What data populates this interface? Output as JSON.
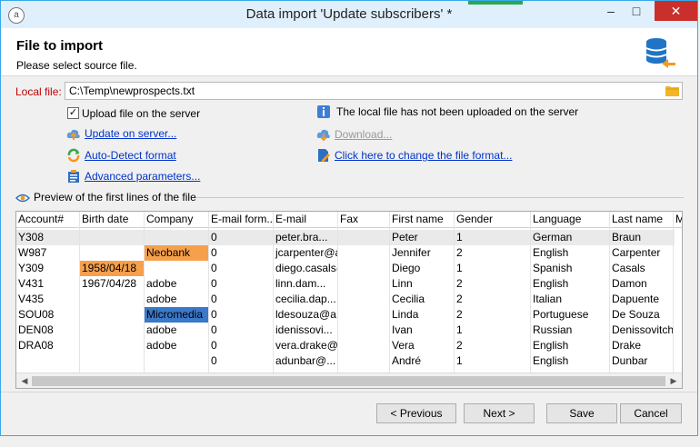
{
  "window": {
    "title": "Data import 'Update subscribers' *",
    "app_icon": "app-logo-icon"
  },
  "header": {
    "title": "File to import",
    "subtitle": "Please select source file."
  },
  "local_file": {
    "label": "Local file:",
    "value": "C:\\Temp\\newprospects.txt"
  },
  "options": {
    "upload_label": "Upload file on the server",
    "upload_checked": true,
    "info_text": "The local file has not been uploaded on the server",
    "update_link": "Update on server...",
    "autodetect_link": "Auto-Detect format",
    "advanced_link": "Advanced parameters...",
    "download_link": "Download...",
    "change_format_link": "Click here to change the file format..."
  },
  "preview": {
    "label": "Preview of the first lines of the file",
    "columns": [
      "Account#",
      "Birth date",
      "Company",
      "E-mail form...",
      "E-mail",
      "Fax",
      "First name",
      "Gender",
      "Language",
      "Last name",
      "M"
    ],
    "rows": [
      [
        "Y308",
        "",
        "",
        "0",
        "peter.bra...",
        "",
        "Peter",
        "1",
        "German",
        "Braun"
      ],
      [
        "W987",
        "",
        "Neobank",
        "0",
        "jcarpenter@a",
        "",
        "Jennifer",
        "2",
        "English",
        "Carpenter"
      ],
      [
        "Y309",
        "1958/04/18",
        "",
        "0",
        "diego.casals@",
        "",
        "Diego",
        "1",
        "Spanish",
        "Casals"
      ],
      [
        "V431",
        "1967/04/28",
        "adobe",
        "0",
        "linn.dam...",
        "",
        "Linn",
        "2",
        "English",
        "Damon"
      ],
      [
        "V435",
        "",
        "adobe",
        "0",
        "cecilia.dap...",
        "",
        "Cecilia",
        "2",
        "Italian",
        "Dapuente"
      ],
      [
        "SOU08",
        "",
        "Micromedia",
        "0",
        "ldesouza@a...",
        "",
        "Linda",
        "2",
        "Portuguese",
        "De Souza"
      ],
      [
        "DEN08",
        "",
        "adobe",
        "0",
        "idenissovi...",
        "",
        "Ivan",
        "1",
        "Russian",
        "Denissovitch"
      ],
      [
        "DRA08",
        "",
        "adobe",
        "0",
        "vera.drake@a",
        "",
        "Vera",
        "2",
        "English",
        "Drake"
      ],
      [
        "",
        "",
        "",
        "0",
        "adunbar@...",
        "",
        "André",
        "1",
        "English",
        "Dunbar"
      ]
    ],
    "highlight_orange": "#f6a04b",
    "highlight_blue": "#3a78c8"
  },
  "buttons": {
    "previous": "< Previous",
    "next": "Next >",
    "save": "Save",
    "cancel": "Cancel"
  }
}
